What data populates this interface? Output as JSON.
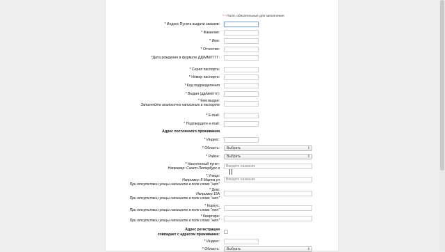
{
  "required_note": {
    "star": "* -",
    "text": "Поля, обязательные для заполнения"
  },
  "fields": {
    "pickup_index": "* Индекс Пункта выдачи заказов:",
    "last_name": "* Фамилия:",
    "first_name": "* Имя:",
    "patronymic": "* Отчество:",
    "birth_date": "*Дата рождения в формате ДД/ММ/ГГГГ:",
    "passport_series": "* Серия паспорта:",
    "passport_number": "* Номер паспорта:",
    "division_code": "* Код подразделения",
    "issued_date": "* Выдан (дд/мм/гггг):",
    "issued_by": "* Кем выдан:",
    "issued_by_hint": "Заполняйте аналогично написанию в паспорте",
    "email": "* E-mail:",
    "email_confirm": "* Подтвердите e-mail:"
  },
  "address_section": {
    "title": "Адрес постоянного проживания",
    "index": "* Индекс:",
    "region": "* Область:",
    "region_value": "Выбрать",
    "district": "* Район:",
    "district_value": "Выбрать",
    "locality": "* Населенный пункт:",
    "locality_hint": "Например: Санкт-Петербург в",
    "locality_placeholder": "Введите название",
    "street": "* Улица:",
    "street_hint1": "Например: 8 Марта ул",
    "street_hint2": "При отсутствии улицы напишите в поле слово \"нет\"",
    "street_placeholder": "Введите название",
    "house": "* Дом:",
    "house_hint1": "Например 15А",
    "house_hint2": "При отсутствии улицы напишите в поле слово \"нет\"",
    "building": "* Корпус:",
    "building_hint": "При отсутствии улицы напишите в поле слово \"нет\"",
    "flat": "* Квартира:",
    "flat_hint": "При отсутствии улицы напишите в поле слово \"нет\""
  },
  "registration": {
    "label1": "Адрес регистрации",
    "label2": "совпадает с адресом проживания:",
    "index": "* Индекс:",
    "region": "* Область:",
    "region_value": "Выбрать"
  }
}
